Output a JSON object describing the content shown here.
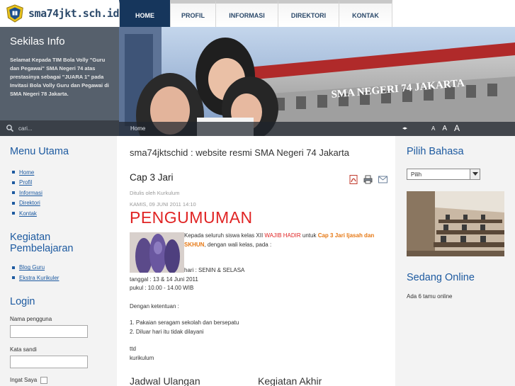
{
  "site": {
    "name": "sma74jkt.sch.id"
  },
  "nav": {
    "items": [
      {
        "label": "HOME"
      },
      {
        "label": "PROFIL"
      },
      {
        "label": "INFORMASI"
      },
      {
        "label": "DIREKTORI"
      },
      {
        "label": "KONTAK"
      }
    ]
  },
  "sekilas": {
    "title": "Sekilas Info",
    "text": "Selamat Kepada TIM Bola Volly \"Guru dan Pegawai\" SMA Negeri 74 atas prestasinya sebagai \"JUARA 1\" pada  Invitasi Bola Volly Guru dan Pegawai di SMA Negeri 78 Jakarta."
  },
  "search": {
    "placeholder": "cari..."
  },
  "banner": {
    "building_sign": "SMA NEGERI 74 JAKARTA",
    "breadcrumb": "Home"
  },
  "menu_utama": {
    "title": "Menu Utama",
    "items": [
      {
        "label": "Home"
      },
      {
        "label": "Profil"
      },
      {
        "label": "Informasi"
      },
      {
        "label": "Direktori"
      },
      {
        "label": "Kontak"
      }
    ]
  },
  "kegiatan": {
    "title": "Kegiatan Pembelajaran",
    "items": [
      {
        "label": "Blog Guru"
      },
      {
        "label": "Ekstra Kurikuler"
      }
    ]
  },
  "login": {
    "title": "Login",
    "username_label": "Nama pengguna",
    "password_label": "Kata sandi",
    "remember_label": "Ingat Saya"
  },
  "main": {
    "site_heading": "sma74jktschid : website resmi SMA Negeri 74 Jakarta",
    "article_title": "Cap 3 Jari",
    "author": "Ditulis oleh Kurkulum",
    "date": "KAMIS, 09 JUNI 2011 14:10",
    "announcement": "PENGUMUMAN",
    "body": {
      "line1_a": "Kepada seluruh siswa kelas XII ",
      "line1_b": "WAJIB HADIR",
      "line1_c": " untuk ",
      "line1_d": "Cap 3 Jari Ijasah dan",
      "line2_a": "SKHUN",
      "line2_b": ", dengan wali kelas, pada :",
      "hari": "hari       : SENIN & SELASA",
      "tanggal": "tanggal : 13 & 14 Juni 2011",
      "pukul": "pukul    : 10.00 - 14.00 WIB",
      "ketentuan": "Dengan ketentuan :",
      "rule1": "1. Pakaian seragam sekolah dan bersepatu",
      "rule2": "2. Diluar hari itu tidak dilayani",
      "ttd": "ttd",
      "signer": "kurikulum"
    },
    "bottom_left": "Jadwal Ulangan",
    "bottom_right": "Kegiatan Akhir"
  },
  "right": {
    "lang_title": "Pilih Bahasa",
    "lang_selected": "Pilih",
    "online_title": "Sedang Online",
    "online_text": "Ada 6 tamu online"
  },
  "colors": {
    "nav_active": "#16365c",
    "heading_blue": "#1d5aa0",
    "announcement_red": "#e02424",
    "highlight_orange": "#e67814"
  }
}
